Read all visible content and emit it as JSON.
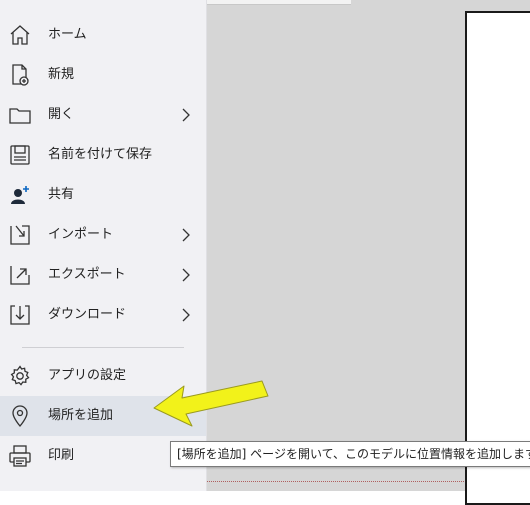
{
  "menu": {
    "items": [
      {
        "label": "ホーム",
        "icon": "home-icon"
      },
      {
        "label": "新規",
        "icon": "new-document-icon"
      },
      {
        "label": "開く",
        "icon": "folder-icon",
        "submenu": true
      },
      {
        "label": "名前を付けて保存",
        "icon": "save-icon"
      },
      {
        "label": "共有",
        "icon": "share-user-icon"
      },
      {
        "label": "インポート",
        "icon": "import-icon",
        "submenu": true
      },
      {
        "label": "エクスポート",
        "icon": "export-icon",
        "submenu": true
      },
      {
        "label": "ダウンロード",
        "icon": "download-icon",
        "submenu": true
      },
      {
        "label": "アプリの設定",
        "icon": "gear-icon"
      },
      {
        "label": "場所を追加",
        "icon": "location-pin-icon",
        "hovered": true
      },
      {
        "label": "印刷",
        "icon": "printer-icon"
      }
    ]
  },
  "tooltip": {
    "text": "[場所を追加] ページを開いて、このモデルに位置情報を追加します。"
  },
  "annotation": {
    "arrow_color": "#f2f21a",
    "arrow_outline": "#9a9a20"
  }
}
